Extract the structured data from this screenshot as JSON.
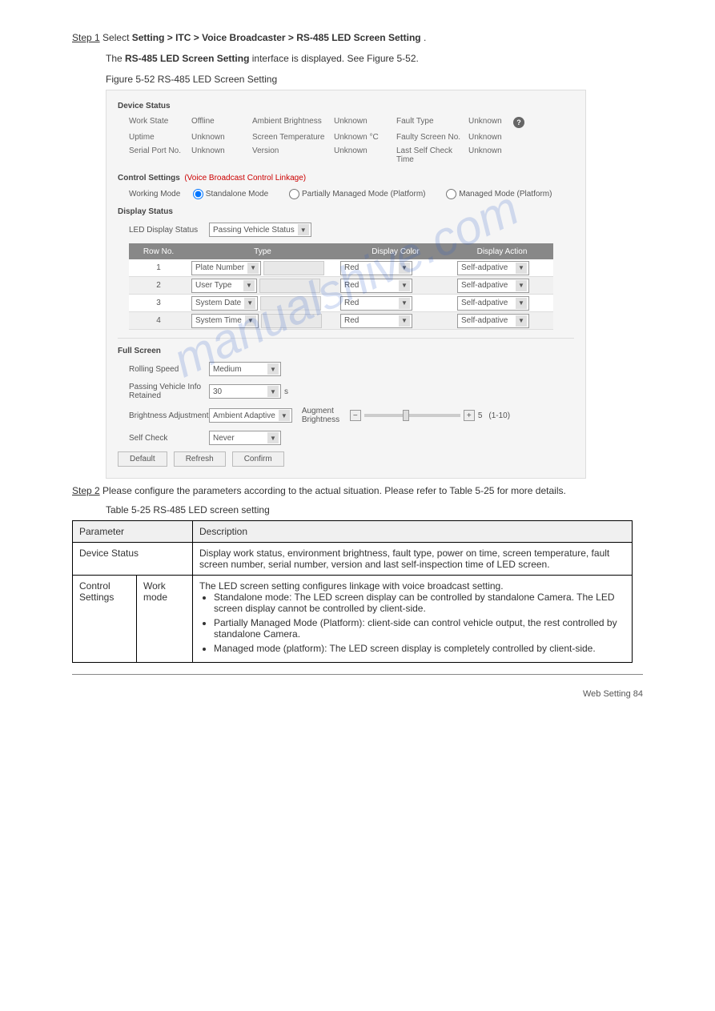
{
  "step1": {
    "label": "Step 1",
    "text1": "Select ",
    "bold1": "Setting > ITC > Voice Broadcaster > RS-485 LED Screen Setting",
    "text2": "."
  },
  "step1b": {
    "text1": "The ",
    "bold1": "RS-485 LED Screen Setting",
    "text2": " interface is displayed. See Figure 5-52."
  },
  "figureCaption": "Figure 5-52 RS-485 LED Screen Setting",
  "panel": {
    "deviceStatusTitle": "Device Status",
    "row1": [
      {
        "label": "Work State",
        "value": "Offline"
      },
      {
        "label": "Ambient Brightness",
        "value": "Unknown"
      },
      {
        "label": "Fault Type",
        "value": "Unknown"
      }
    ],
    "row2": [
      {
        "label": "Uptime",
        "value": "Unknown"
      },
      {
        "label": "Screen Temperature",
        "value": "Unknown °C"
      },
      {
        "label": "Faulty Screen No.",
        "value": "Unknown"
      }
    ],
    "row3": [
      {
        "label": "Serial Port No.",
        "value": "Unknown"
      },
      {
        "label": "Version",
        "value": "Unknown"
      },
      {
        "label": "Last Self Check Time",
        "value": "Unknown"
      }
    ],
    "controlSettingsTitle": "Control Settings",
    "controlLinkage": "(Voice Broadcast Control Linkage)",
    "workingModeLabel": "Working Mode",
    "modes": [
      "Standalone Mode",
      "Partially Managed Mode (Platform)",
      "Managed Mode (Platform)"
    ],
    "displayStatusTitle": "Display Status",
    "ledDisplayStatusLabel": "LED Display Status",
    "ledDisplayStatusValue": "Passing Vehicle Status",
    "tableHeaders": [
      "Row No.",
      "Type",
      "Display Color",
      "Display Action"
    ],
    "tableRows": [
      {
        "no": "1",
        "type": "Plate Number",
        "color": "Red",
        "action": "Self-adpative"
      },
      {
        "no": "2",
        "type": "User Type",
        "color": "Red",
        "action": "Self-adpative"
      },
      {
        "no": "3",
        "type": "System Date",
        "color": "Red",
        "action": "Self-adpative"
      },
      {
        "no": "4",
        "type": "System Time",
        "color": "Red",
        "action": "Self-adpative"
      }
    ],
    "fullScreenTitle": "Full Screen",
    "rollingSpeedLabel": "Rolling Speed",
    "rollingSpeedValue": "Medium",
    "passingVehicleLabel": "Passing Vehicle Info Retained",
    "passingVehicleValue": "30",
    "passingVehicleUnit": "s",
    "brightnessLabel": "Brightness Adjustment",
    "brightnessValue": "Ambient Adaptive",
    "augmentLabel": "Augment Brightness",
    "augmentValue": "5",
    "augmentRange": "(1-10)",
    "selfCheckLabel": "Self Check",
    "selfCheckValue": "Never",
    "buttons": [
      "Default",
      "Refresh",
      "Confirm"
    ]
  },
  "step2": {
    "label": "Step 2",
    "text": "Please configure the parameters according to the actual situation. Please refer to Table 5-25 for more details."
  },
  "tableCaption": "Table 5-25 RS-485 LED screen setting",
  "descTable": {
    "headers": [
      "Parameter",
      "",
      "Description"
    ],
    "rows": [
      {
        "p1": "Device Status",
        "p2": "",
        "desc": "Display work status, environment brightness, fault type, power on time, screen temperature, fault screen number, serial number, version and last self-inspection time of LED screen."
      },
      {
        "p1": "Control Settings",
        "p2": "Work mode",
        "desc_intro": "The LED screen setting configures linkage with voice broadcast setting.",
        "desc_items": [
          "Standalone mode: The LED screen display can be controlled by standalone Camera. The LED screen display cannot be controlled by client-side.",
          "Partially Managed Mode (Platform): client-side can control vehicle output, the rest controlled by standalone Camera.",
          "Managed mode (platform): The LED screen display is completely controlled by client-side."
        ]
      }
    ]
  },
  "footer": {
    "text": "Web Setting  84"
  }
}
